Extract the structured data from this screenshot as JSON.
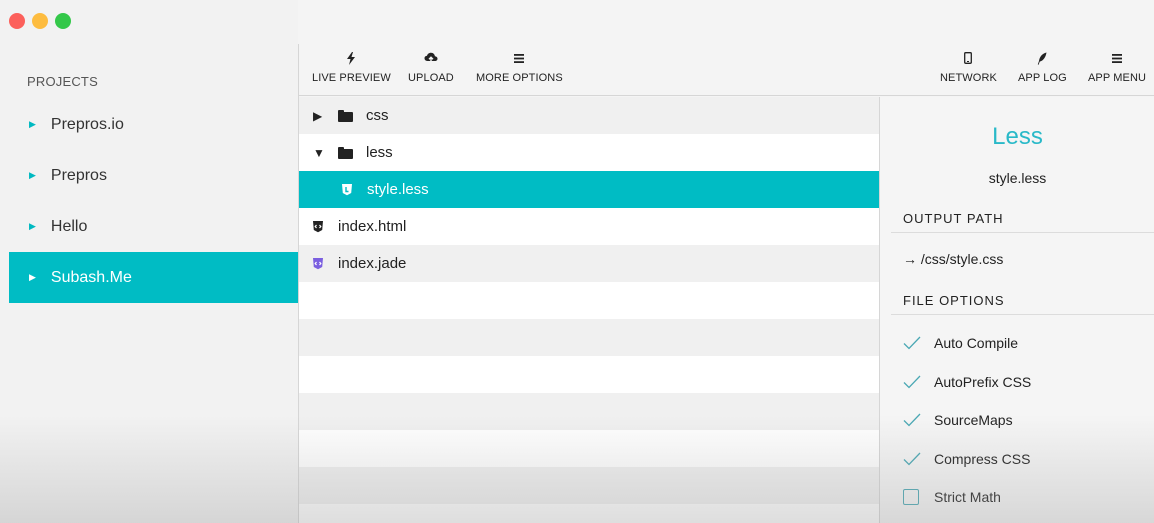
{
  "sidebar": {
    "heading": "PROJECTS",
    "projects": [
      {
        "label": "Prepros.io"
      },
      {
        "label": "Prepros"
      },
      {
        "label": "Hello"
      },
      {
        "label": "Subash.Me"
      }
    ],
    "active_index": 3
  },
  "toolbar": {
    "left": [
      {
        "label": "LIVE PREVIEW",
        "icon": "lightning-icon"
      },
      {
        "label": "UPLOAD",
        "icon": "cloud-upload-icon"
      },
      {
        "label": "MORE OPTIONS",
        "icon": "hamburger-icon"
      }
    ],
    "right": [
      {
        "label": "NETWORK",
        "icon": "mobile-device-icon"
      },
      {
        "label": "APP LOG",
        "icon": "feather-icon"
      },
      {
        "label": "APP MENU",
        "icon": "hamburger-icon"
      }
    ]
  },
  "files": [
    {
      "name": "css",
      "type": "folder",
      "expanded": false
    },
    {
      "name": "less",
      "type": "folder",
      "expanded": true
    },
    {
      "name": "style.less",
      "type": "file",
      "icon": "less-shield-icon",
      "selected": true
    },
    {
      "name": "index.html",
      "type": "file",
      "icon": "html-shield-icon"
    },
    {
      "name": "index.jade",
      "type": "file",
      "icon": "jade-shield-icon"
    }
  ],
  "details": {
    "language": "Less",
    "file_name": "style.less",
    "output_path_heading": "OUTPUT PATH",
    "output_path": "→ /css/style.css",
    "file_options_heading": "FILE OPTIONS",
    "options": [
      {
        "label": "Auto Compile",
        "checked": true
      },
      {
        "label": "AutoPrefix CSS",
        "checked": true
      },
      {
        "label": "SourceMaps",
        "checked": true
      },
      {
        "label": "Compress CSS",
        "checked": true
      },
      {
        "label": "Strict Math",
        "checked": false
      }
    ]
  },
  "colors": {
    "accent": "#00bcc4",
    "title_blue": "#29b9c8",
    "jade_purple": "#7b5fe0"
  }
}
